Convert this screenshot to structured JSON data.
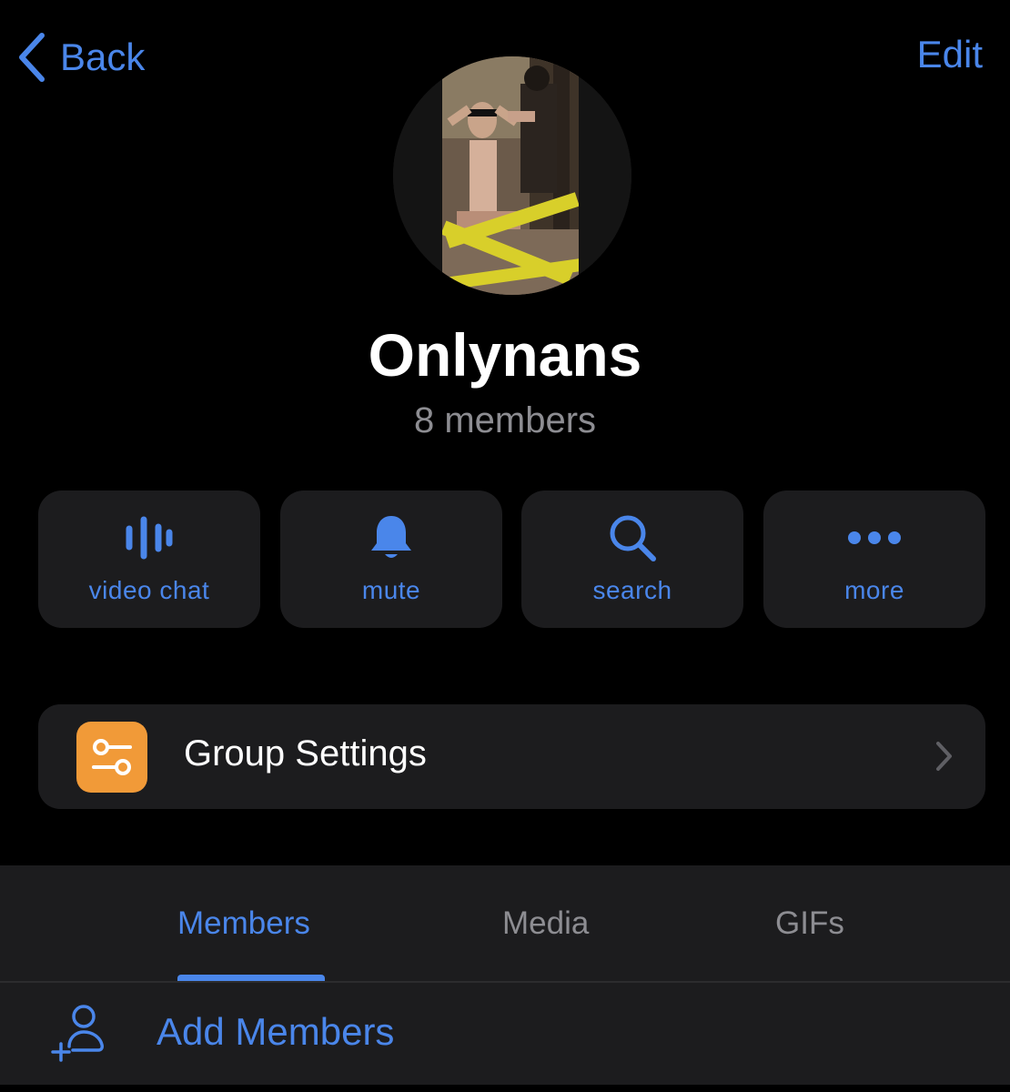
{
  "nav": {
    "back_label": "Back",
    "edit_label": "Edit"
  },
  "group": {
    "name": "Onlynans",
    "member_count": "8 members",
    "avatar_icon": "group-avatar-photo"
  },
  "actions": [
    {
      "label": "video chat",
      "icon": "voice-chat-icon"
    },
    {
      "label": "mute",
      "icon": "bell-icon"
    },
    {
      "label": "search",
      "icon": "search-icon"
    },
    {
      "label": "more",
      "icon": "more-icon"
    }
  ],
  "settings": {
    "label": "Group Settings",
    "icon": "toggles-icon",
    "icon_color": "#f19a38"
  },
  "tabs": [
    {
      "label": "Members",
      "active": true
    },
    {
      "label": "Media",
      "active": false
    },
    {
      "label": "GIFs",
      "active": false
    }
  ],
  "add_members": {
    "label": "Add Members",
    "icon": "add-person-icon"
  },
  "colors": {
    "accent": "#4a86ea",
    "background": "#000000",
    "surface": "#1c1c1e",
    "secondary_text": "#8d8d92"
  }
}
